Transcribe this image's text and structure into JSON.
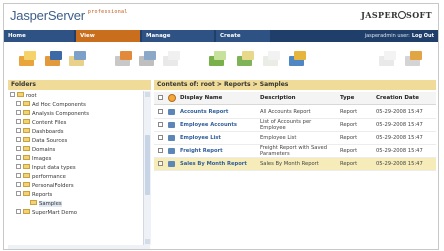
{
  "header": {
    "brand": "JasperServer",
    "edition": "professional",
    "logo_left": "JASPER",
    "logo_right": "SOFT"
  },
  "nav": {
    "tabs": [
      "Home",
      "View",
      "Manage",
      "Create"
    ],
    "active_tab": "View",
    "user_text": "jasperadmin user:",
    "logout_label": "Log Out"
  },
  "toolbar": {
    "buttons": [
      "new-folder",
      "edit-properties",
      "copy",
      "schedule",
      "run",
      "export",
      "import",
      "cut",
      "paste",
      "delete",
      "settings",
      "edit"
    ]
  },
  "folders": {
    "title": "Folders",
    "items": [
      {
        "label": "root",
        "expander": "minus"
      },
      {
        "label": "Ad Hoc Components",
        "expander": "plus"
      },
      {
        "label": "Analysis Components",
        "expander": "plus"
      },
      {
        "label": "Content Files",
        "expander": "plus"
      },
      {
        "label": "Dashboards",
        "expander": "plus"
      },
      {
        "label": "Data Sources",
        "expander": "plus"
      },
      {
        "label": "Domains",
        "expander": "plus"
      },
      {
        "label": "Images",
        "expander": "plus"
      },
      {
        "label": "Input data types",
        "expander": "plus"
      },
      {
        "label": "performance",
        "expander": "plus"
      },
      {
        "label": "PersonalFolders",
        "expander": "plus"
      },
      {
        "label": "Reports",
        "expander": "minus"
      },
      {
        "label": "Samples",
        "expander": "none",
        "selected": true
      },
      {
        "label": "SuperMart Demo",
        "expander": "plus"
      }
    ]
  },
  "content": {
    "breadcrumb": "Contents of: root > Reports > Samples",
    "columns": {
      "name": "Display Name",
      "description": "Description",
      "type": "Type",
      "date": "Creation Date"
    },
    "rows": [
      {
        "name": "Accounts Report",
        "description": "All Accounts Report",
        "type": "Report",
        "date": "05-29-2008 15:47",
        "selected": false
      },
      {
        "name": "Employee Accounts",
        "description": "List of Accounts per Employee",
        "type": "Report",
        "date": "05-29-2008 15:47",
        "selected": false
      },
      {
        "name": "Employee List",
        "description": "Employee List",
        "type": "Report",
        "date": "05-29-2008 15:47",
        "selected": false
      },
      {
        "name": "Freight Report",
        "description": "Freight Report with Saved Parameters",
        "type": "Report",
        "date": "05-29-2008 15:47",
        "selected": false
      },
      {
        "name": "Sales By Month Report",
        "description": "Sales By Month Report",
        "type": "Report",
        "date": "05-29-2008 15:47",
        "selected": true
      }
    ]
  },
  "colors": {
    "nav_bg": "#1f3f6a",
    "tab_bg": "#2e5284",
    "tab_active_bg": "#c86e1c",
    "panel_header": "#f0dc98",
    "selected_row": "#f6ecba",
    "link": "#2e5d9b"
  }
}
